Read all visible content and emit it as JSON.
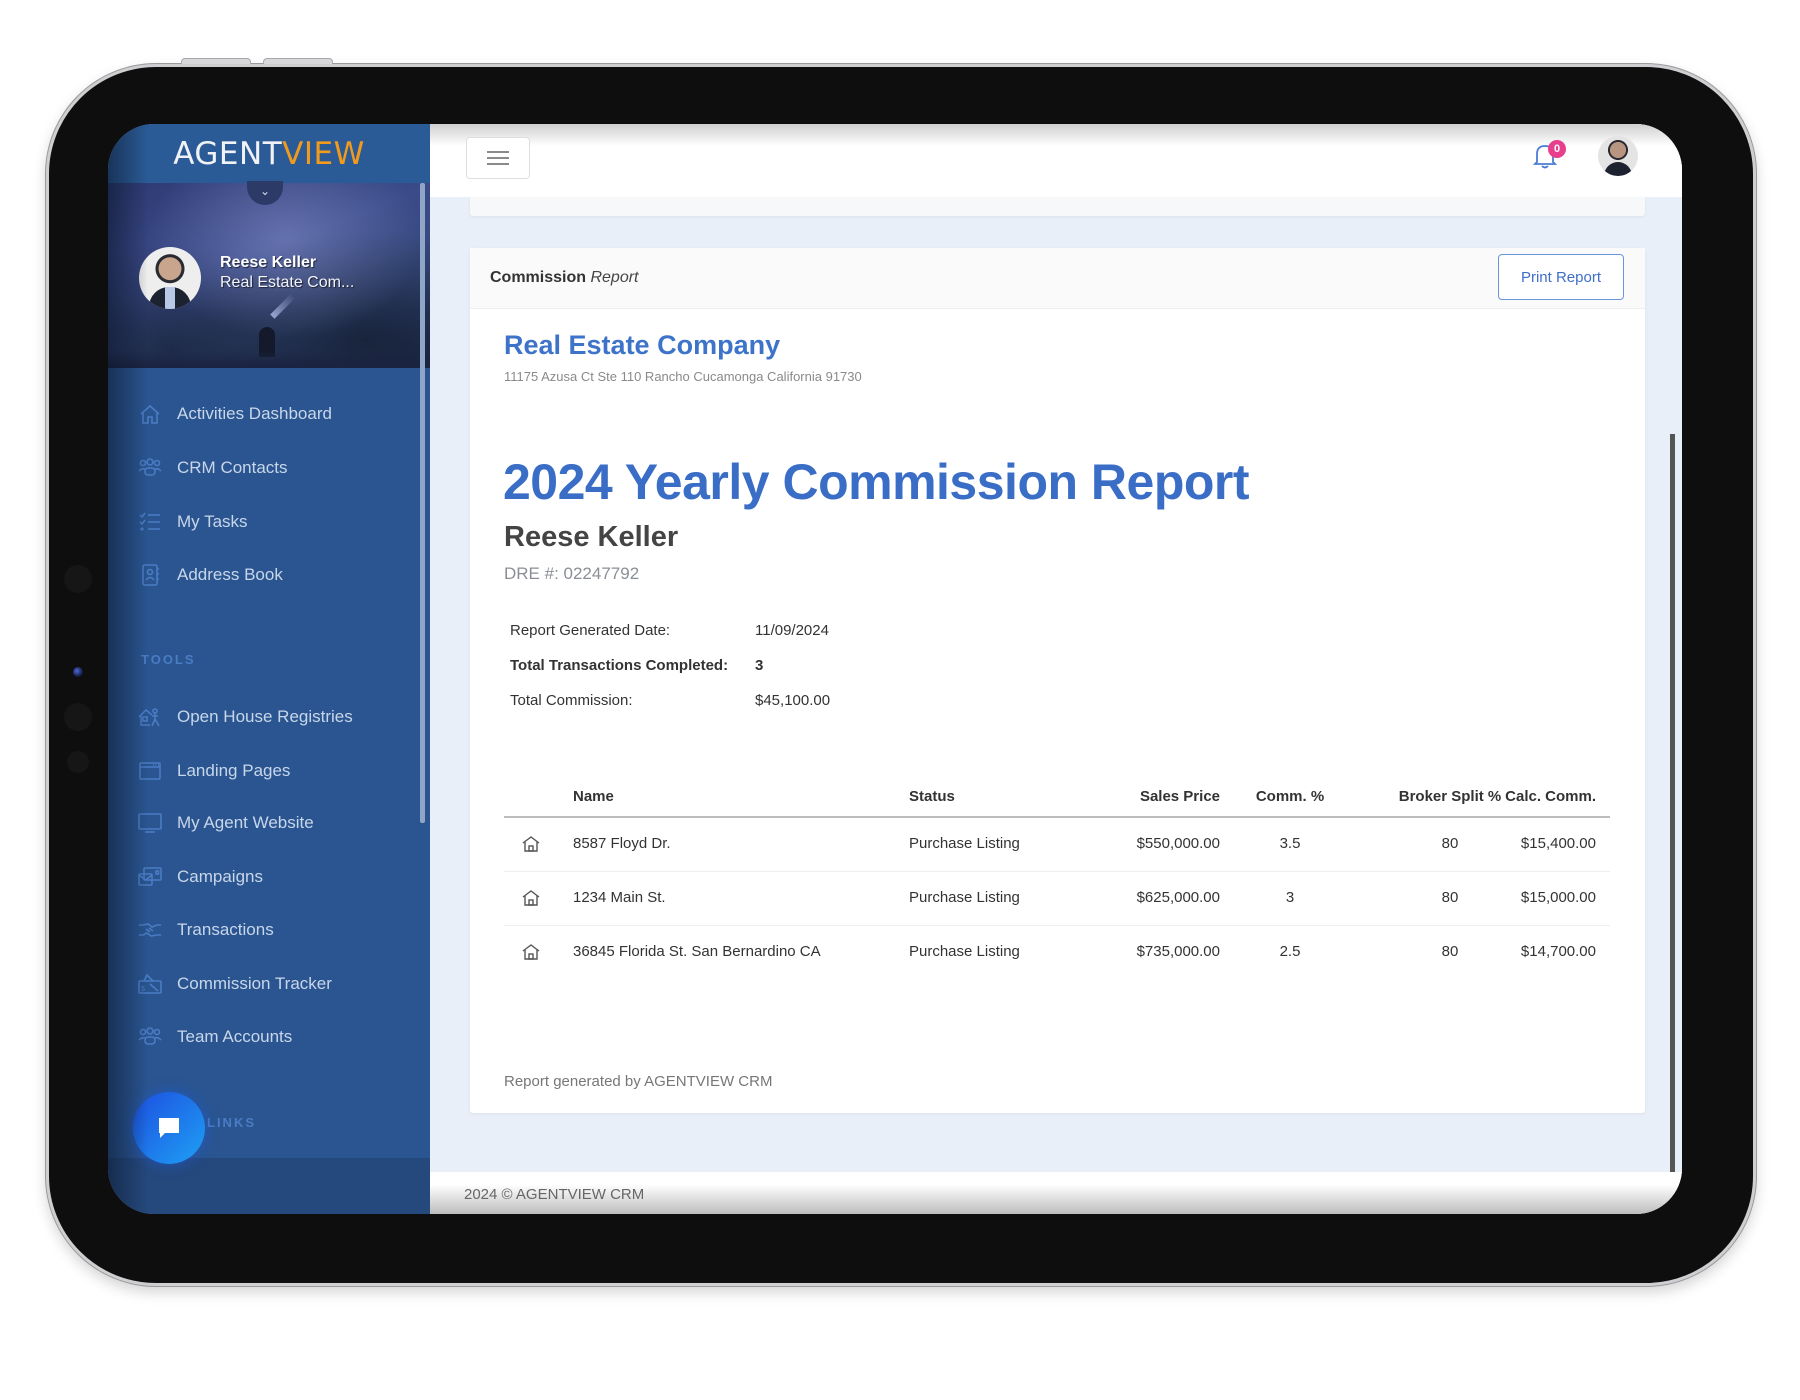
{
  "app": {
    "logo_primary": "AGENT",
    "logo_accent": "VIEW",
    "accent_color": "#3d74c9",
    "logo_accent_color": "#f29a1c"
  },
  "profile": {
    "name": "Reese Keller",
    "company": "Real Estate Com...",
    "toggle_icon": "chevron-down-icon"
  },
  "sidebar": {
    "main_items": [
      {
        "label": "Activities Dashboard",
        "icon": "home-icon"
      },
      {
        "label": "CRM Contacts",
        "icon": "contacts-icon"
      },
      {
        "label": "My Tasks",
        "icon": "tasks-icon"
      },
      {
        "label": "Address Book",
        "icon": "address-book-icon"
      }
    ],
    "tools_label": "TOOLS",
    "tool_items": [
      {
        "label": "Open House Registries",
        "icon": "open-house-icon"
      },
      {
        "label": "Landing Pages",
        "icon": "landing-page-icon"
      },
      {
        "label": "My Agent Website",
        "icon": "monitor-icon"
      },
      {
        "label": "Campaigns",
        "icon": "campaigns-icon"
      },
      {
        "label": "Transactions",
        "icon": "handshake-icon"
      },
      {
        "label": "Commission Tracker",
        "icon": "commission-icon"
      },
      {
        "label": "Team Accounts",
        "icon": "team-icon"
      }
    ],
    "links_label": "LINKS"
  },
  "topbar": {
    "menu_icon": "hamburger-icon",
    "notification_count": "0"
  },
  "card": {
    "title_bold": "Commission",
    "title_italic": "Report",
    "print_button": "Print Report"
  },
  "report": {
    "company": "Real Estate Company",
    "address": "11175 Azusa Ct Ste 110 Rancho Cucamonga California 91730",
    "title": "2024 Yearly Commission Report",
    "agent_name": "Reese Keller",
    "dre": "DRE #: 02247792",
    "summary": [
      {
        "label": "Report Generated Date:",
        "value": "11/09/2024",
        "bold": false
      },
      {
        "label": "Total Transactions Completed:",
        "value": "3",
        "bold": true
      },
      {
        "label": "Total Commission:",
        "value": "$45,100.00",
        "bold": false
      }
    ],
    "table": {
      "headers": [
        "Name",
        "Status",
        "Sales Price",
        "Comm. %",
        "Broker Split %",
        "Calc. Comm."
      ],
      "rows": [
        {
          "icon": "house-icon",
          "name": "8587 Floyd Dr.",
          "status": "Purchase Listing",
          "sales_price": "$550,000.00",
          "comm_pct": "3.5",
          "broker_split": "80",
          "calc_comm": "$15,400.00"
        },
        {
          "icon": "house-icon",
          "name": "1234 Main St.",
          "status": "Purchase Listing",
          "sales_price": "$625,000.00",
          "comm_pct": "3",
          "broker_split": "80",
          "calc_comm": "$15,000.00"
        },
        {
          "icon": "house-icon",
          "name": "36845 Florida St. San Bernardino CA",
          "status": "Purchase Listing",
          "sales_price": "$735,000.00",
          "comm_pct": "2.5",
          "broker_split": "80",
          "calc_comm": "$14,700.00"
        }
      ]
    },
    "footer": "Report generated by AGENTVIEW CRM"
  },
  "page_footer": "2024 © AGENTVIEW CRM"
}
